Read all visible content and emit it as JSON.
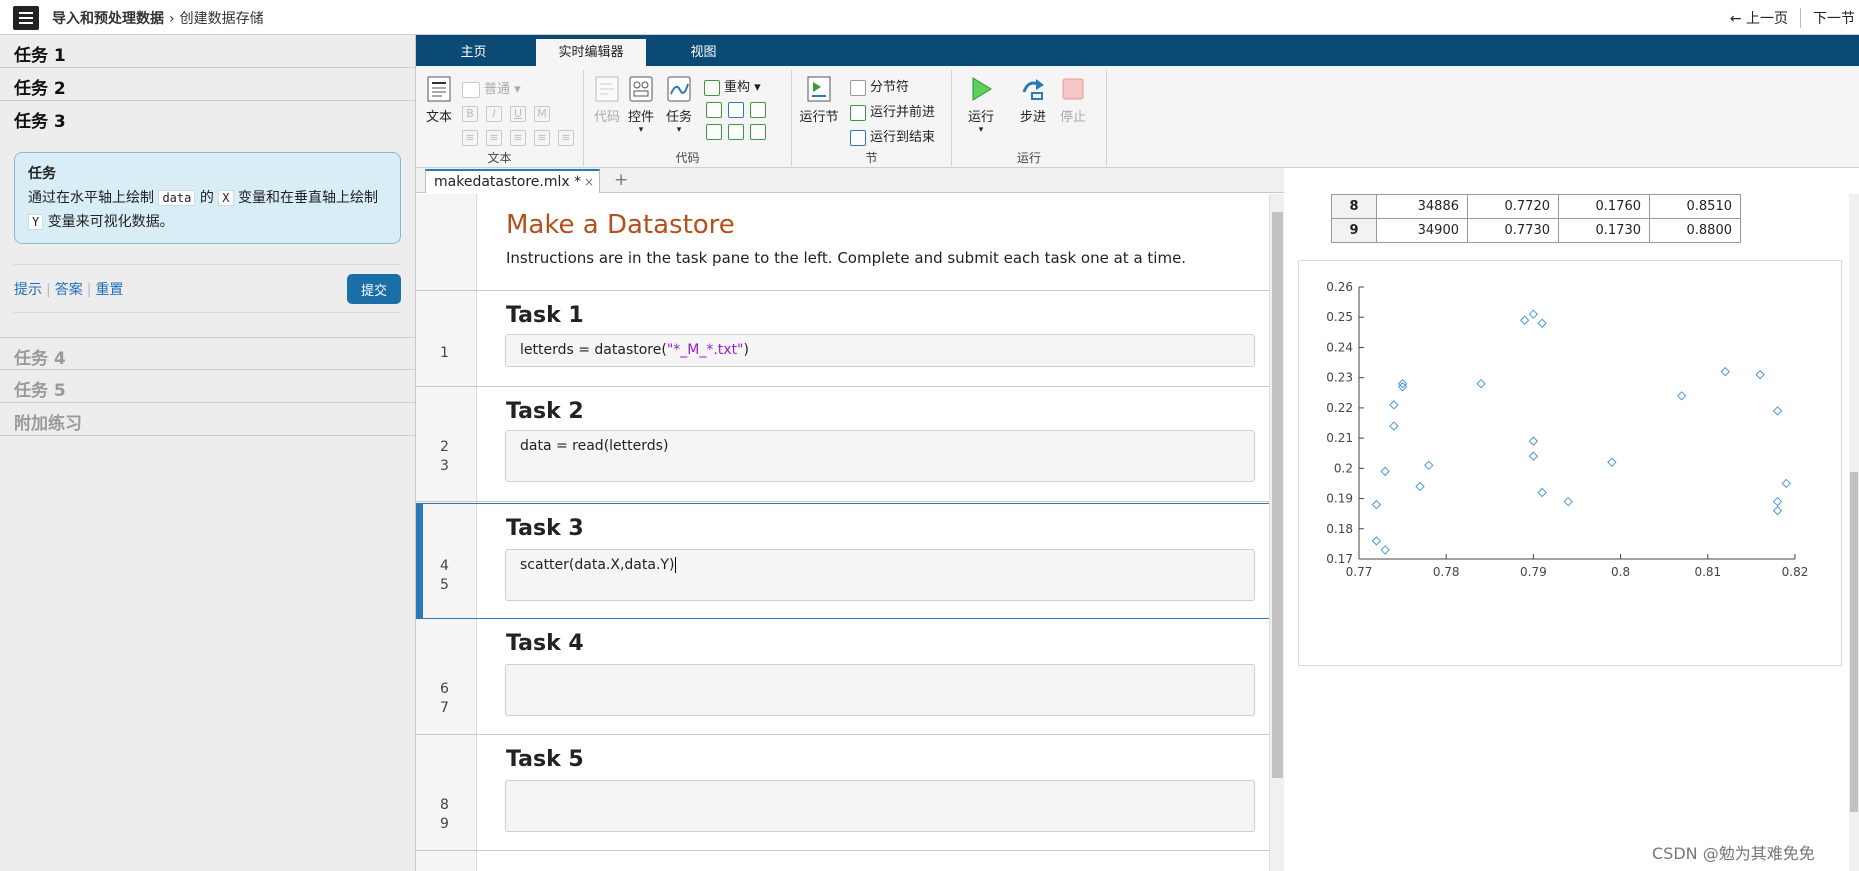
{
  "breadcrumb": {
    "course": "导入和预处理数据",
    "separator": "›",
    "page": "创建数据存储"
  },
  "nav": {
    "prev": "← 上一页",
    "next": "下一节"
  },
  "tasks": {
    "items": [
      "任务 1",
      "任务 2",
      "任务 3"
    ],
    "later": [
      "任务 4",
      "任务 5",
      "附加练习"
    ]
  },
  "task_card": {
    "heading": "任务",
    "text1": "通过在水平轴上绘制",
    "code1": "data",
    "text2": "的",
    "code2": "X",
    "text3": "变量和在垂直轴上绘制",
    "code3": "Y",
    "text4": "变量来可视化数据。"
  },
  "task_actions": {
    "hint": "提示",
    "answer": "答案",
    "reset": "重置",
    "submit": "提交"
  },
  "ribbon_tabs": [
    "主页",
    "实时编辑器",
    "视图"
  ],
  "ribbon": {
    "text_group": {
      "label": "文本",
      "text_btn": "文本",
      "style": "普通"
    },
    "code_group": {
      "label": "代码",
      "code_btn": "代码",
      "control_btn": "控件",
      "task_btn": "任务",
      "refactor": "重构"
    },
    "section_group": {
      "label": "节",
      "run_section": "运行节",
      "section_break": "分节符",
      "run_and_advance": "运行并前进",
      "run_to_end": "运行到结束"
    },
    "run_group": {
      "label": "运行",
      "run": "运行",
      "step": "步进",
      "stop": "停止"
    }
  },
  "doc_tab": {
    "name": "makedatastore.mlx *",
    "close": "×",
    "add": "+"
  },
  "editor": {
    "title": "Make a Datastore",
    "instructions": "Instructions are in the task pane to the left. Complete and submit each task one at a time.",
    "sections": [
      {
        "title": "Task 1",
        "lines": [
          "1"
        ],
        "code_prefix": "letterds = datastore(",
        "code_string": "\"*_M_*.txt\"",
        "code_suffix": ")"
      },
      {
        "title": "Task 2",
        "lines": [
          "2",
          "3"
        ],
        "code": "data = read(letterds)"
      },
      {
        "title": "Task 3",
        "lines": [
          "4",
          "5"
        ],
        "code": "scatter(data.X,data.Y)"
      },
      {
        "title": "Task 4",
        "lines": [
          "6",
          "7"
        ],
        "code": ""
      },
      {
        "title": "Task 5",
        "lines": [
          "8",
          "9"
        ],
        "code": ""
      }
    ]
  },
  "output_table": {
    "rows": [
      [
        "8",
        "34886",
        "0.7720",
        "0.1760",
        "0.8510"
      ],
      [
        "9",
        "34900",
        "0.7730",
        "0.1730",
        "0.8800"
      ]
    ]
  },
  "chart_data": {
    "type": "scatter",
    "xlim": [
      0.77,
      0.82
    ],
    "ylim": [
      0.17,
      0.26
    ],
    "x_ticks": [
      "0.77",
      "0.78",
      "0.79",
      "0.8",
      "0.81",
      "0.82"
    ],
    "y_ticks": [
      "0.17",
      "0.18",
      "0.19",
      "0.2",
      "0.21",
      "0.22",
      "0.23",
      "0.24",
      "0.25",
      "0.26"
    ],
    "marker_color": "#4a9ad6",
    "points": [
      [
        0.772,
        0.188
      ],
      [
        0.772,
        0.176
      ],
      [
        0.773,
        0.173
      ],
      [
        0.773,
        0.199
      ],
      [
        0.774,
        0.214
      ],
      [
        0.774,
        0.221
      ],
      [
        0.775,
        0.227
      ],
      [
        0.775,
        0.228
      ],
      [
        0.777,
        0.194
      ],
      [
        0.778,
        0.201
      ],
      [
        0.784,
        0.228
      ],
      [
        0.789,
        0.249
      ],
      [
        0.79,
        0.251
      ],
      [
        0.791,
        0.248
      ],
      [
        0.79,
        0.209
      ],
      [
        0.79,
        0.204
      ],
      [
        0.791,
        0.192
      ],
      [
        0.794,
        0.189
      ],
      [
        0.799,
        0.202
      ],
      [
        0.807,
        0.224
      ],
      [
        0.812,
        0.232
      ],
      [
        0.816,
        0.231
      ],
      [
        0.818,
        0.219
      ],
      [
        0.818,
        0.189
      ],
      [
        0.818,
        0.186
      ],
      [
        0.819,
        0.195
      ]
    ]
  },
  "watermark": "CSDN @勉为其难免免"
}
